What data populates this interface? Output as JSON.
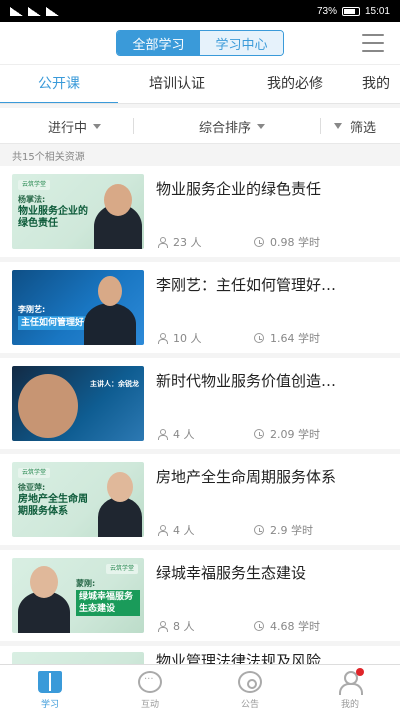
{
  "status_bar": {
    "battery": "73%",
    "time": "15:01"
  },
  "header": {
    "segments": [
      "全部学习",
      "学习中心"
    ],
    "active_segment": 0
  },
  "tabs": [
    "公开课",
    "培训认证",
    "我的必修",
    "我的"
  ],
  "filters": {
    "status": "进行中",
    "sort": "综合排序",
    "filter": "筛选"
  },
  "result_count": "共15个相关资源",
  "courses": [
    {
      "title": "物业服务企业的绿色责任",
      "learners": "23 人",
      "hours": "0.98 学时",
      "thumb_title": "物业服务企业的绿色责任",
      "thumb_speaker": "杨掌法:",
      "thumb_badge": "云筑学堂"
    },
    {
      "title": "李刚艺：主任如何管理好…",
      "learners": "10 人",
      "hours": "1.64 学时",
      "thumb_title": "主任如何管理好设备",
      "thumb_speaker": "李刚艺:"
    },
    {
      "title": "新时代物业服务价值创造…",
      "learners": "4 人",
      "hours": "2.09 学时",
      "thumb_title": "主讲人：余锐龙"
    },
    {
      "title": "房地产全生命周期服务体系",
      "learners": "4 人",
      "hours": "2.9 学时",
      "thumb_title": "房地产全生命周期服务体系",
      "thumb_speaker": "徐亚萍:",
      "thumb_badge": "云筑学堂"
    },
    {
      "title": "绿城幸福服务生态建设",
      "learners": "8 人",
      "hours": "4.68 学时",
      "thumb_title": "绿城幸福服务生态建设",
      "thumb_speaker": "蒙刚:",
      "thumb_badge": "云筑学堂"
    },
    {
      "title": "物业管理法律法规及风险"
    }
  ],
  "bottom_nav": [
    {
      "label": "学习",
      "icon": "book-icon"
    },
    {
      "label": "互动",
      "icon": "chat-icon"
    },
    {
      "label": "公告",
      "icon": "broadcast-icon"
    },
    {
      "label": "我的",
      "icon": "user-icon"
    }
  ],
  "colors": {
    "accent": "#3a9ad9",
    "badge_red": "#e0252a",
    "thumb_green": "#1a9b5a"
  }
}
